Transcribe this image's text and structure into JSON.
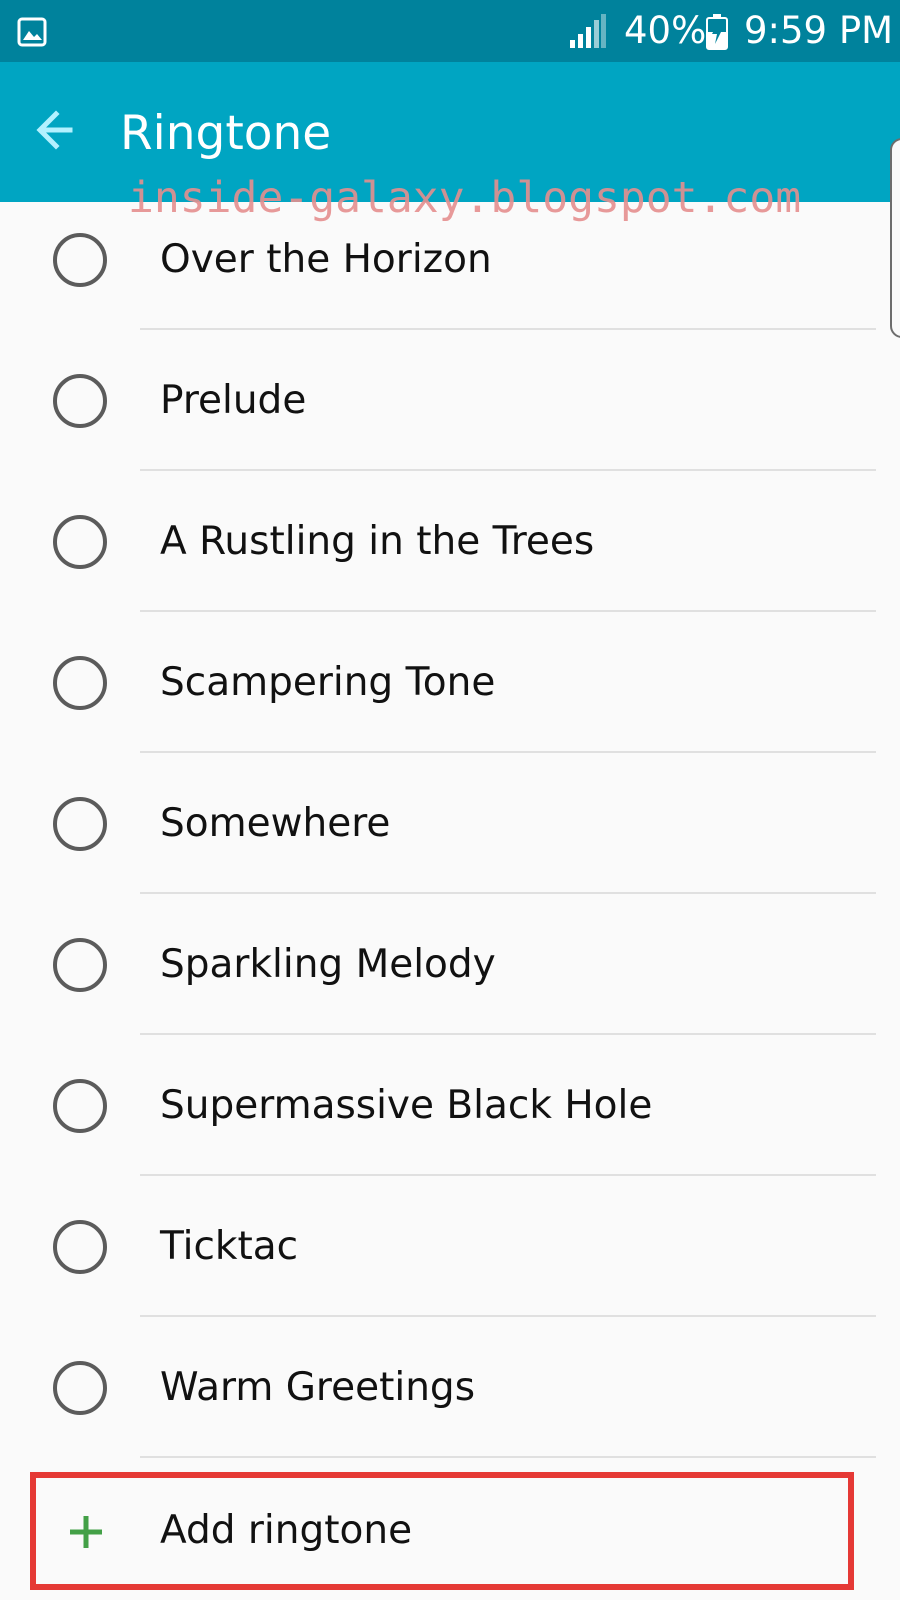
{
  "status_bar": {
    "battery": "40%",
    "time": "9:59 PM",
    "icons": [
      "gallery-icon",
      "signal-icon",
      "battery-charging-icon"
    ]
  },
  "app_bar": {
    "title": "Ringtone",
    "back_icon": "arrow-back-icon"
  },
  "watermark": "inside-galaxy.blogspot.com",
  "ringtones": [
    "Over the Horizon",
    "Prelude",
    "A Rustling in the Trees",
    "Scampering Tone",
    "Somewhere",
    "Sparkling Melody",
    "Supermassive Black Hole",
    "Ticktac",
    "Warm Greetings"
  ],
  "add_ringtone": {
    "label": "Add ringtone",
    "icon": "plus-icon"
  },
  "colors": {
    "status_bar": "#00829c",
    "app_bar": "#00a5c2",
    "highlight_border": "#e53935",
    "plus_icon": "#43a047",
    "back_arrow": "#b3f1ff"
  }
}
